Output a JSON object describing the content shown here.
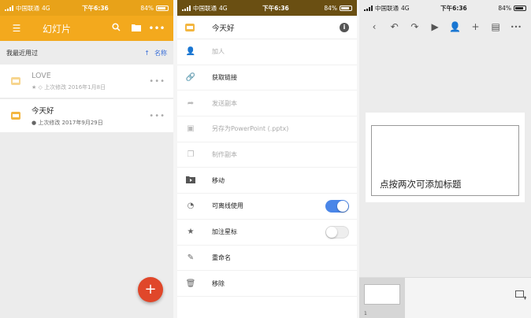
{
  "status": {
    "carrier": "中国联通",
    "network": "4G",
    "time": "下午6:36",
    "battery": "84%"
  },
  "list_screen": {
    "title": "幻灯片",
    "section_label": "我最近用过",
    "sort_label": "名称",
    "files": [
      {
        "name": "LOVE",
        "meta": "上次修改 2016年1月8日",
        "faded": true
      },
      {
        "name": "今天好",
        "meta": "上次修改 2017年9月29日",
        "faded": false
      }
    ],
    "fab_label": "+"
  },
  "menu_screen": {
    "file_title": "今天好",
    "items": [
      {
        "label": "加人",
        "icon": "add-person-icon",
        "disabled": true
      },
      {
        "label": "获取链接",
        "icon": "link-icon",
        "disabled": false
      },
      {
        "label": "发送副本",
        "icon": "share-arrow-icon",
        "disabled": true
      },
      {
        "label": "另存为PowerPoint (.pptx)",
        "icon": "powerpoint-icon",
        "disabled": true
      },
      {
        "label": "制作副本",
        "icon": "copy-icon",
        "disabled": true
      },
      {
        "label": "移动",
        "icon": "move-folder-icon",
        "disabled": false
      },
      {
        "label": "可离线使用",
        "icon": "offline-icon",
        "disabled": false,
        "toggle": "on"
      },
      {
        "label": "加注星标",
        "icon": "star-icon",
        "disabled": false,
        "toggle": "off"
      },
      {
        "label": "重命名",
        "icon": "rename-icon",
        "disabled": false
      },
      {
        "label": "移除",
        "icon": "trash-icon",
        "disabled": false
      }
    ]
  },
  "editor_screen": {
    "placeholder_title": "点按两次可添加标题",
    "slide_number": "1"
  },
  "colors": {
    "accent": "#f3a91d",
    "fab": "#e0472a",
    "toggle_on": "#4a86e8",
    "link": "#3a6fd8"
  }
}
